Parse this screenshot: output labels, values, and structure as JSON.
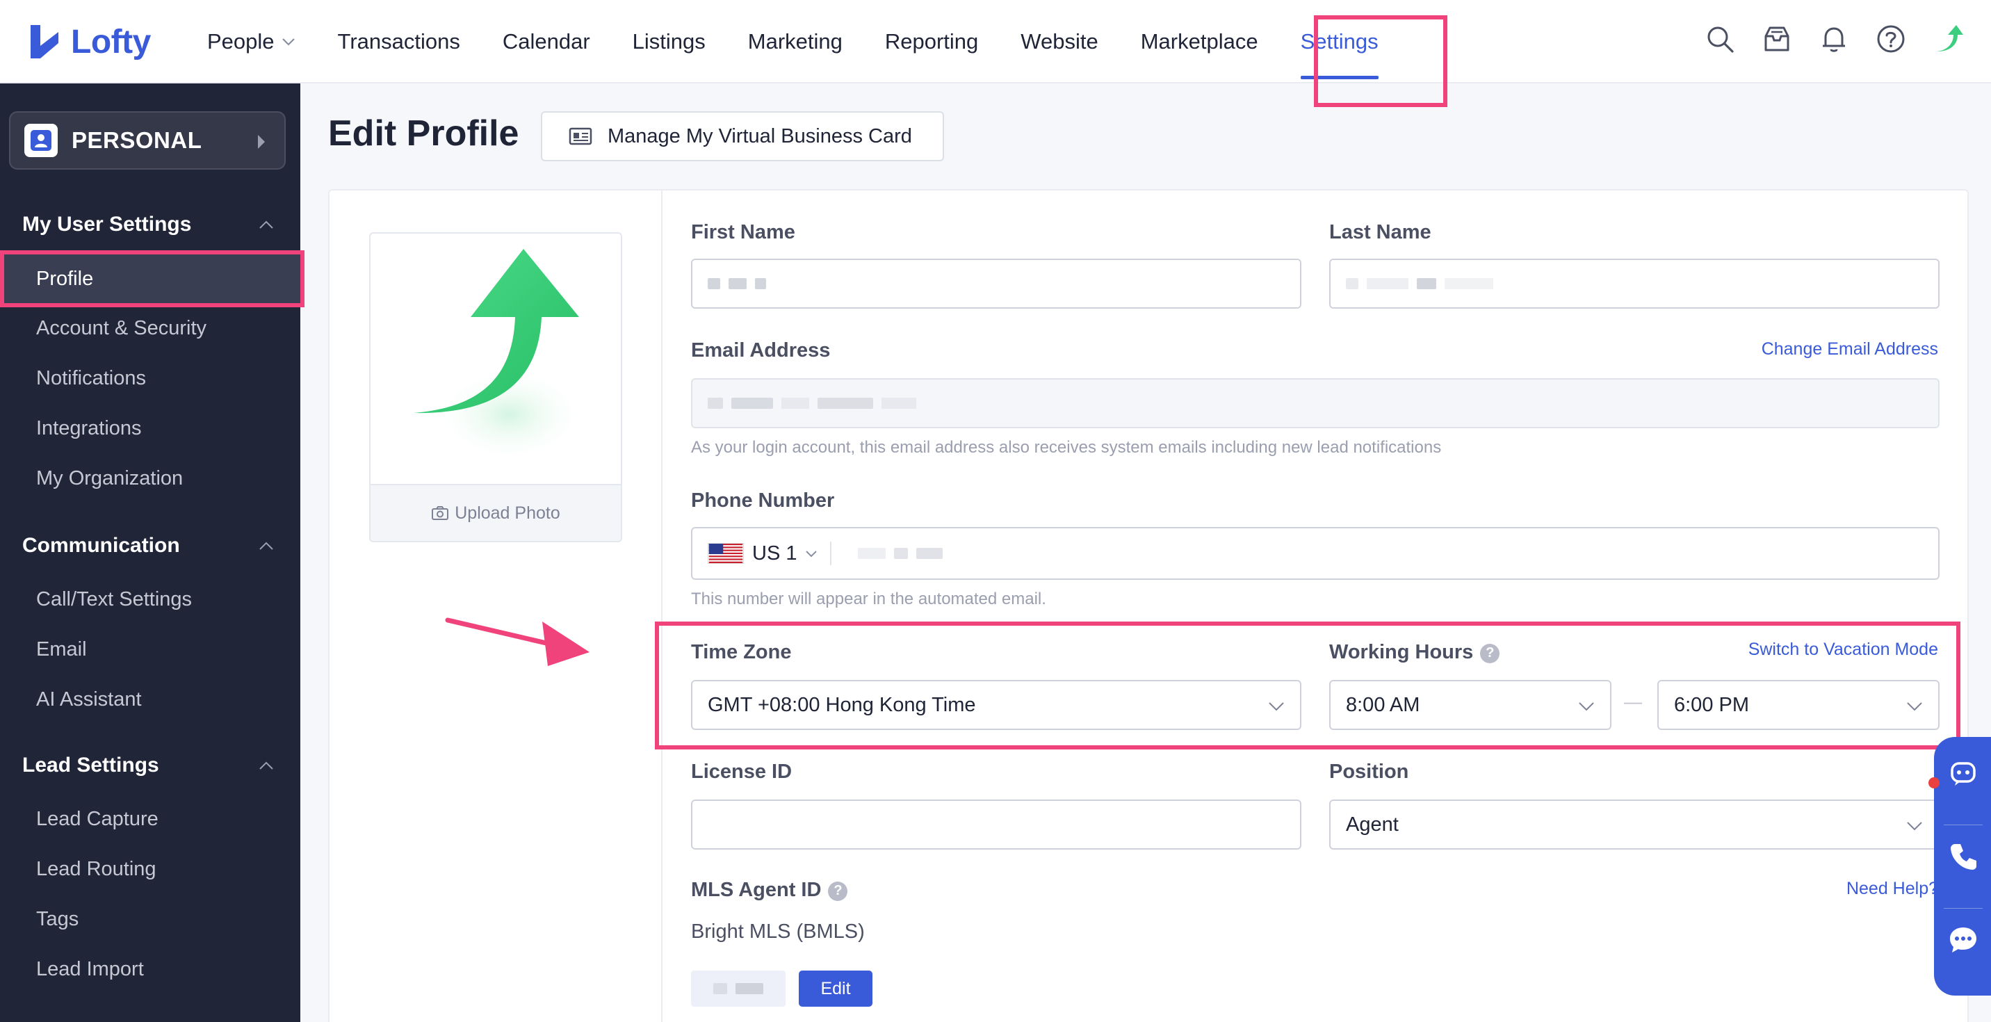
{
  "app": {
    "name": "Lofty"
  },
  "nav": {
    "items": [
      "People",
      "Transactions",
      "Calendar",
      "Listings",
      "Marketing",
      "Reporting",
      "Website",
      "Marketplace"
    ],
    "active": "Settings"
  },
  "sidebar": {
    "account_type": "PERSONAL",
    "sections": {
      "user": {
        "title": "My User Settings",
        "items": [
          "Profile",
          "Account & Security",
          "Notifications",
          "Integrations",
          "My Organization"
        ]
      },
      "communication": {
        "title": "Communication",
        "items": [
          "Call/Text Settings",
          "Email",
          "AI Assistant"
        ]
      },
      "lead": {
        "title": "Lead Settings",
        "items": [
          "Lead Capture",
          "Lead Routing",
          "Tags",
          "Lead Import"
        ]
      }
    }
  },
  "page": {
    "title": "Edit Profile",
    "vcard_button": "Manage My Virtual Business Card",
    "upload_photo": "Upload Photo"
  },
  "form": {
    "first_name": {
      "label": "First Name"
    },
    "last_name": {
      "label": "Last Name"
    },
    "email": {
      "label": "Email Address",
      "change_link": "Change Email Address",
      "hint": "As your login account, this email address also receives system emails including new lead notifications"
    },
    "phone": {
      "label": "Phone Number",
      "country_code": "US 1",
      "hint": "This number will appear in the automated email."
    },
    "time_zone": {
      "label": "Time Zone",
      "value": "GMT +08:00 Hong Kong Time"
    },
    "working_hours": {
      "label": "Working Hours",
      "start": "8:00 AM",
      "end": "6:00 PM",
      "separator": "—",
      "vacation_link": "Switch to Vacation Mode"
    },
    "license": {
      "label": "License ID"
    },
    "position": {
      "label": "Position",
      "value": "Agent"
    },
    "mls": {
      "label": "MLS Agent ID",
      "help_link": "Need Help?",
      "board": "Bright MLS (BMLS)",
      "edit_button": "Edit"
    }
  },
  "colors": {
    "accent": "#3a5bd9",
    "sidebar_bg": "#212538",
    "highlight": "#f0427b",
    "logo_green": "#3cce7e"
  }
}
